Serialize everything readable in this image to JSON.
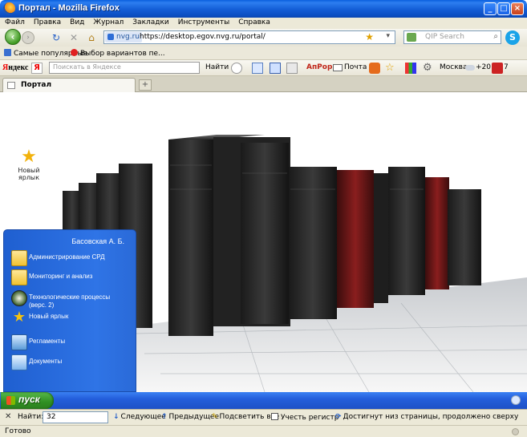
{
  "window": {
    "title": "Портал - Mozilla Firefox"
  },
  "menu": [
    "Файл",
    "Правка",
    "Вид",
    "Журнал",
    "Закладки",
    "Инструменты",
    "Справка"
  ],
  "nav": {
    "site_badge": "nvg.ru",
    "url": "https://desktop.egov.nvg.ru/portal/",
    "search_placeholder": "QIP Search"
  },
  "bookmarks": [
    {
      "label": "Самые популярные",
      "icon": "bookmark-icon"
    },
    {
      "label": "Выбор вариантов пе...",
      "icon": "avast-icon"
    }
  ],
  "yandex_bar": {
    "logo_prefix": "Я",
    "logo_suffix": "ндекс",
    "badge": "Я",
    "search_placeholder": "Поискать в Яндексе",
    "find": "Найти",
    "anpop": "АпРор",
    "mail": "Почта",
    "city": "Москва",
    "temp": "+20",
    "count": "7"
  },
  "tabs": [
    {
      "label": "Портал",
      "active": true
    }
  ],
  "desktop": {
    "shortcut_label": "Новый ярлык"
  },
  "start_panel": {
    "user": "Басовская А. Б.",
    "items": [
      {
        "label": "Администрирование СРД",
        "icon": "folder-icon"
      },
      {
        "label": "Мониторинг и анализ",
        "icon": "folder-icon"
      },
      {
        "label": "Технологические процессы (верс. 2)",
        "icon": "gauge-icon"
      },
      {
        "label": "Новый ярлык",
        "icon": "star-icon"
      },
      {
        "label": "Регламенты",
        "icon": "flowchart-icon"
      },
      {
        "label": "Документы",
        "icon": "document-icon"
      }
    ]
  },
  "taskbar": {
    "start_label": "пуск"
  },
  "findbar": {
    "label": "Найти:",
    "value": "32",
    "next": "Следующее",
    "prev": "Предыдущее",
    "highlight": "Подсветить все",
    "match_case": "Учесть регистр",
    "status": "Достигнут низ страницы, продолжено сверху"
  },
  "status": {
    "text": "Готово"
  }
}
